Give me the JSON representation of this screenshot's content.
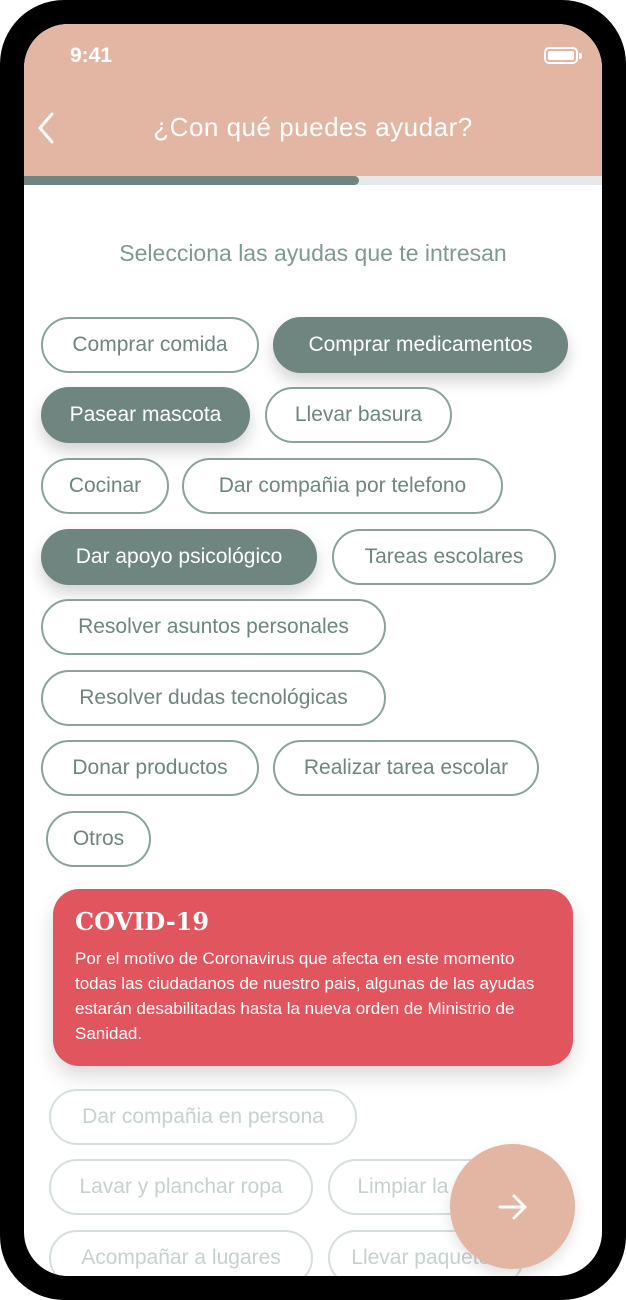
{
  "status_bar": {
    "time": "9:41"
  },
  "header": {
    "title": "¿Con qué puedes ayudar?"
  },
  "progress": {
    "value": 0.58
  },
  "subtitle": "Selecciona las ayudas que te intresan",
  "options": [
    {
      "label": "Comprar comida",
      "state": "unselected"
    },
    {
      "label": "Comprar medicamentos",
      "state": "selected"
    },
    {
      "label": "Pasear mascota",
      "state": "selected"
    },
    {
      "label": "Llevar basura",
      "state": "unselected"
    },
    {
      "label": "Cocinar",
      "state": "unselected"
    },
    {
      "label": "Dar compañia por telefono",
      "state": "unselected"
    },
    {
      "label": "Dar apoyo psicológico",
      "state": "selected"
    },
    {
      "label": "Tareas escolares",
      "state": "unselected"
    },
    {
      "label": "Resolver asuntos personales",
      "state": "unselected"
    },
    {
      "label": "Resolver dudas tecnológicas",
      "state": "unselected"
    },
    {
      "label": "Donar productos",
      "state": "unselected"
    },
    {
      "label": "Realizar tarea escolar",
      "state": "unselected"
    },
    {
      "label": "Otros",
      "state": "unselected"
    }
  ],
  "covid": {
    "title": "COVID-19",
    "text": "Por el motivo de Coronavirus que afecta en este momento todas las ciudadanos de nuestro pais, algunas de las ayudas estarán desabilitadas hasta la nueva orden de Ministrio de Sanidad."
  },
  "disabled_options": [
    {
      "label": "Dar compañia en persona"
    },
    {
      "label": "Lavar y planchar ropa"
    },
    {
      "label": "Limpiar la casa"
    },
    {
      "label": "Acompañar a lugares"
    },
    {
      "label": "Llevar paquetes"
    }
  ],
  "next_button": {
    "icon": "arrow-right-icon"
  },
  "colors": {
    "header": "#e2b6a3",
    "selected_chip": "#6e8580",
    "chip_border": "#8aa19c",
    "covid_card": "#e0555e",
    "progress_track": "#e6e9ea"
  }
}
